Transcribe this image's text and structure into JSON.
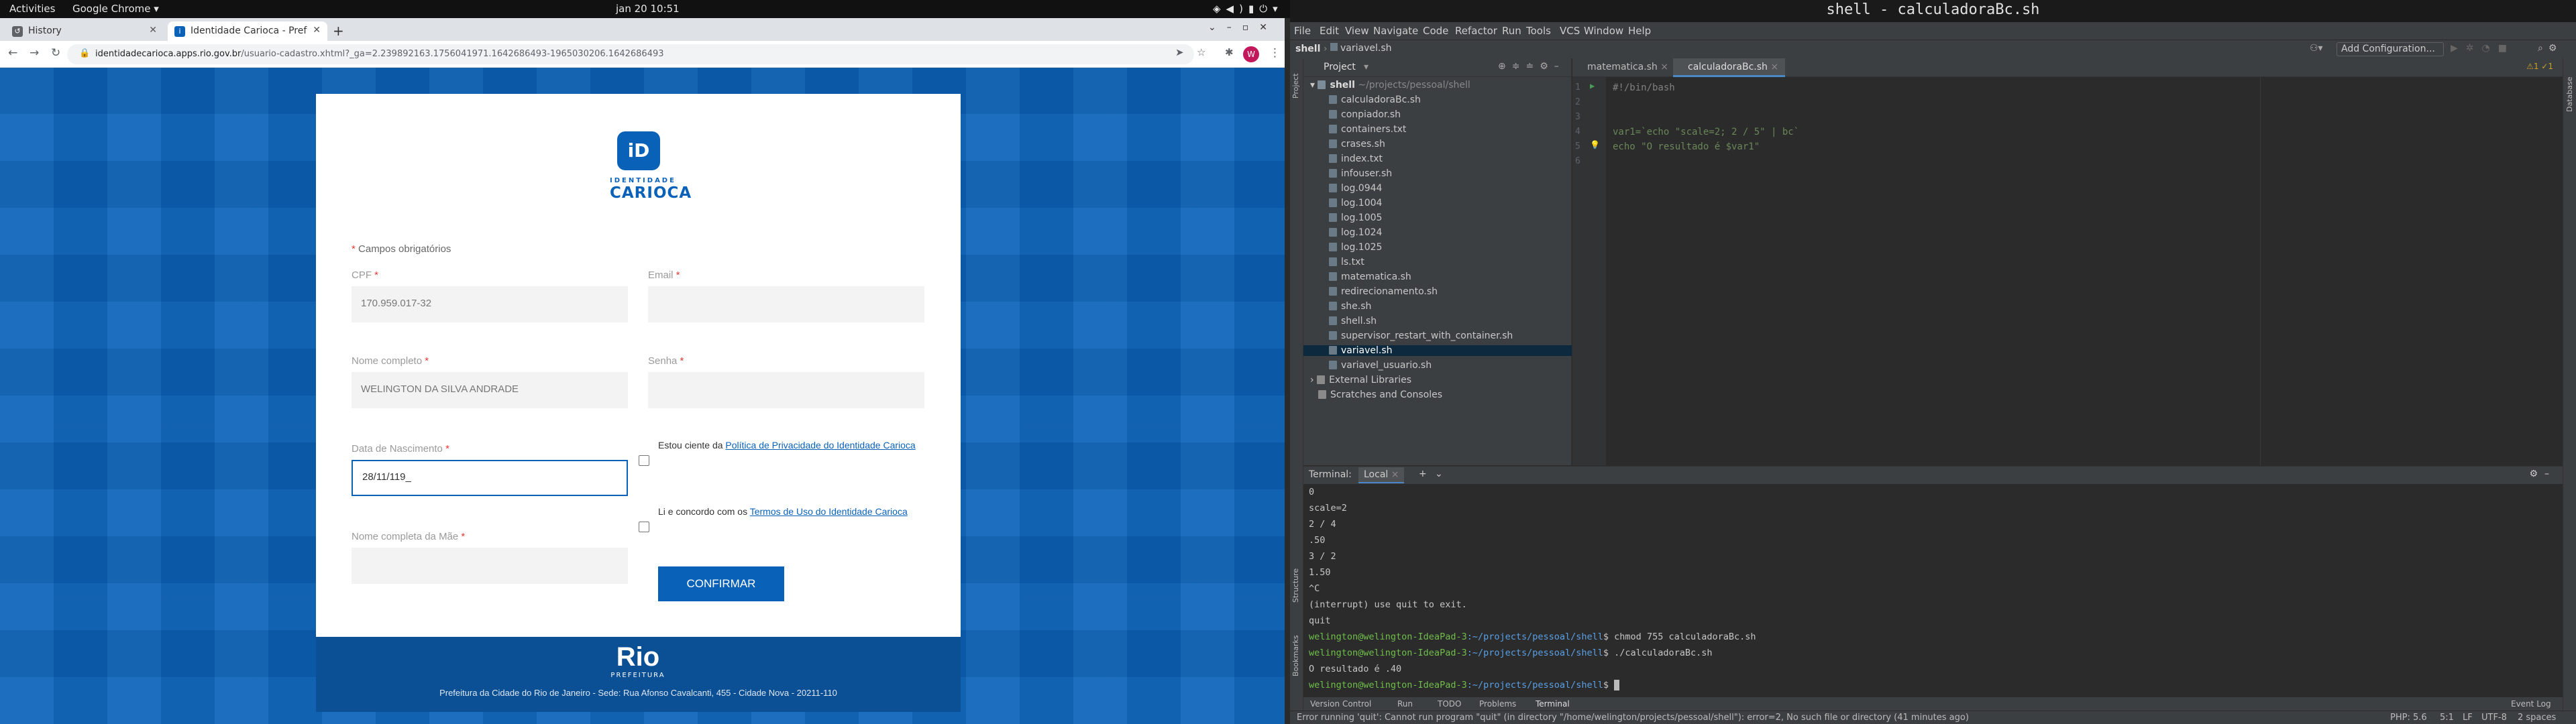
{
  "system": {
    "activities": "Activities",
    "app_menu": "Google Chrome ▾",
    "clock": "jan 20  10:51",
    "tray_icons": [
      "network-icon",
      "volume-icon",
      "power-icon",
      "battery-icon"
    ]
  },
  "browser": {
    "tabs": [
      {
        "label": "History",
        "icon": "history-icon"
      },
      {
        "label": "Identidade Carioca - Pref",
        "icon": "identidade-carioca-favicon"
      }
    ],
    "url_host": "identidadecarioca.apps.rio.gov.br",
    "url_path": "/usuario-cadastro.xhtml?_ga=2.239892163.1756041971.1642686493-1965030206.1642686493",
    "avatar_letter": "W"
  },
  "form": {
    "logo_line1": "IDENTIDADE",
    "logo_line2": "CARIOCA",
    "required_note": "Campos obrigatórios",
    "cpf_label": "CPF",
    "cpf_value": "170.959.017-32",
    "email_label": "Email",
    "email_value": "",
    "nome_label": "Nome completo",
    "nome_value": "WELINGTON DA SILVA ANDRADE",
    "senha_label": "Senha",
    "senha_value": "",
    "nasc_label": "Data de Nascimento",
    "nasc_value": "28/11/119_",
    "mae_label": "Nome completa da Mãe",
    "mae_value": "",
    "privacy_text": "Estou ciente da ",
    "privacy_link": "Política de Privacidade do Identidade Carioca",
    "terms_text": "Li e concordo com os ",
    "terms_link": "Termos de Uso do Identidade Carioca",
    "confirm_label": "CONFIRMAR",
    "required_mark": "*"
  },
  "footer": {
    "brand": "Rio",
    "brand_sub": "PREFEITURA",
    "address": "Prefeitura da Cidade do Rio de Janeiro - Sede: Rua Afonso Cavalcanti, 455 - Cidade Nova - 20211-110"
  },
  "ide": {
    "title": "shell - calculadoraBc.sh",
    "menu": [
      "File",
      "Edit",
      "View",
      "Navigate",
      "Code",
      "Refactor",
      "Run",
      "Tools",
      "VCS",
      "Window",
      "Help"
    ],
    "breadcrumb_project": "shell",
    "breadcrumb_file": "variavel.sh",
    "add_configuration": "Add Configuration...",
    "project_panel_title": "Project",
    "project_root": "shell",
    "project_root_path": "~/projects/pessoal/shell",
    "files": [
      "calculadoraBc.sh",
      "conpiador.sh",
      "containers.txt",
      "crases.sh",
      "index.txt",
      "infouser.sh",
      "log.0944",
      "log.1004",
      "log.1005",
      "log.1024",
      "log.1025",
      "ls.txt",
      "matematica.sh",
      "redirecionamento.sh",
      "she.sh",
      "shell.sh",
      "supervisor_restart_with_container.sh",
      "variavel.sh",
      "variavel_usuario.sh"
    ],
    "selected_file": "variavel.sh",
    "external_libraries": "External Libraries",
    "scratches": "Scratches and Consoles",
    "editor_tabs": [
      "matematica.sh",
      "calculadoraBc.sh"
    ],
    "active_editor_tab": "calculadoraBc.sh",
    "code_lines": [
      "#!/bin/bash",
      "",
      "",
      "var1=`echo \"scale=2; 2 / 5\" | bc`",
      "echo \"O resultado é $var1\"",
      ""
    ],
    "line_numbers": [
      "1",
      "2",
      "3",
      "4",
      "5",
      "6"
    ],
    "inspection_counts": "⚠1  ✓1",
    "terminal_label": "Terminal:",
    "terminal_tab": "Local",
    "terminal_lines": [
      "0",
      "scale=2",
      "2 / 4",
      ".50",
      "3 / 2",
      "1.50",
      "^C",
      "(interrupt) use quit to exit.",
      "quit"
    ],
    "prompt_user": "welington@welington-IdeaPad-3",
    "prompt_path": ":~/projects/pessoal/shell",
    "cmd1": "chmod 755 calculadoraBc.sh",
    "cmd2": "./calculadoraBc.sh",
    "output1": "O resultado é .40",
    "bottom_tabs": [
      "Version Control",
      "Run",
      "TODO",
      "Problems",
      "Terminal"
    ],
    "event_log": "Event Log",
    "status_message": "Error running 'quit': Cannot run program \"quit\" (in directory \"/home/welington/projects/pessoal/shell\"): error=2, No such file or directory (41 minutes ago)",
    "status_right": [
      "PHP: 5.6",
      "5:1",
      "LF",
      "UTF-8",
      "2 spaces"
    ],
    "side_labels_left": [
      "Project",
      "Structure",
      "Bookmarks"
    ],
    "side_labels_right": [
      "Database"
    ]
  }
}
